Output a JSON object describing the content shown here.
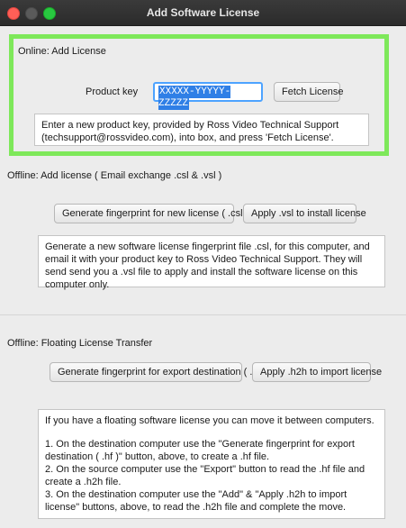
{
  "window": {
    "title": "Add Software License"
  },
  "online": {
    "heading": "Online: Add License",
    "product_key_label": "Product key",
    "product_key_value": "XXXXX-YYYYY-ZZZZZ",
    "fetch_button": "Fetch License",
    "info": "Enter a new product key, provided by Ross Video Technical Support (techsupport@rossvideo.com), into box, and press 'Fetch License'."
  },
  "offline": {
    "heading": "Offline: Add license ( Email exchange .csl & .vsl )",
    "generate_button": "Generate fingerprint for new license ( .csl )",
    "apply_button": "Apply .vsl to install license",
    "info": "Generate a new software license fingerprint file .csl, for this computer, and email it with your product key to Ross Video Technical Support. They will send send you a .vsl file to apply and install the software license on this computer only."
  },
  "floating": {
    "heading": "Offline: Floating License Transfer",
    "generate_button": "Generate fingerprint for export destination ( .hf )",
    "apply_button": "Apply .h2h to import license",
    "info_lines": [
      "If you have a floating software license you can move it between computers.",
      "1. On the destination computer use the \"Generate fingerprint for export destination ( .hf )\" button, above, to create a .hf file.",
      "2. On the source computer use the \"Export\" button to read the .hf file and create a .h2h file.",
      "3. On the destination computer use the \"Add\" & \"Apply .h2h to import license\" buttons, above, to read the .h2h file and complete the move."
    ]
  }
}
